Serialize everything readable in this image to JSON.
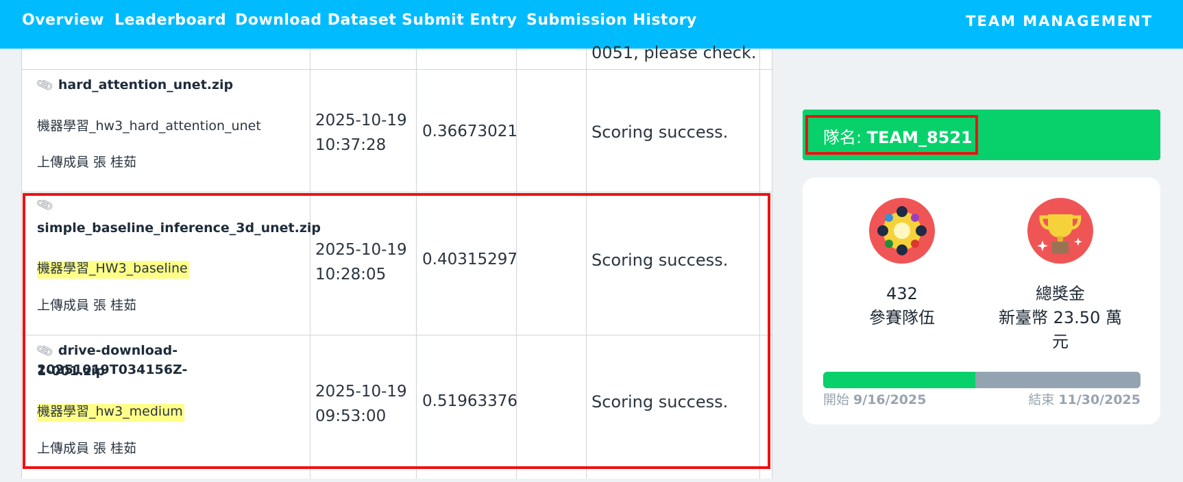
{
  "nav": {
    "overview": "Overview",
    "leaderboard": "Leaderboard",
    "download": "Download Dataset",
    "submit": "Submit Entry",
    "history": "Submission History",
    "team_mgmt": "TEAM MANAGEMENT"
  },
  "table": {
    "prev_row_status_tail": "0051, please check.",
    "rows": [
      {
        "file": "hard_attention_unet.zip",
        "description": "機器學習_hw3_hard_attention_unet",
        "uploader": "上傳成員 張 桂茹",
        "date": "2025-10-19",
        "time": "10:37:28",
        "score": "0.36673021",
        "status": "Scoring success."
      },
      {
        "file": "simple_baseline_inference_3d_unet.zip",
        "description": "機器學習_HW3_baseline",
        "uploader": "上傳成員 張 桂茹",
        "date": "2025-10-19",
        "time": "10:28:05",
        "score": "0.40315297",
        "status": "Scoring success."
      },
      {
        "file_line1": "drive-download-20251019T034156Z-",
        "file_line2": "1-001.zip",
        "description": "機器學習_hw3_medium",
        "uploader": "上傳成員 張 桂茹",
        "date": "2025-10-19",
        "time": "09:53:00",
        "score": "0.51963376",
        "status": "Scoring success."
      }
    ]
  },
  "team": {
    "label": "隊名: ",
    "name": "TEAM_8521"
  },
  "stats": {
    "teams_count": "432",
    "teams_label": "參賽隊伍",
    "prize_label": "總獎金",
    "prize_line1": "新臺幣 23.50 萬",
    "prize_line2": "元",
    "progress_fraction": 0.48,
    "start_label": "開始 ",
    "start_date": "9/16/2025",
    "end_label": "結束 ",
    "end_date": "11/30/2025"
  },
  "icons": {
    "teams": "teams-network-icon",
    "prize": "trophy-icon",
    "attachment": "paperclip-icon"
  },
  "colors": {
    "navbar": "#00bcff",
    "team_bar": "#08d16b",
    "highlight": "#ffff88",
    "annotation": "#ee1111"
  }
}
